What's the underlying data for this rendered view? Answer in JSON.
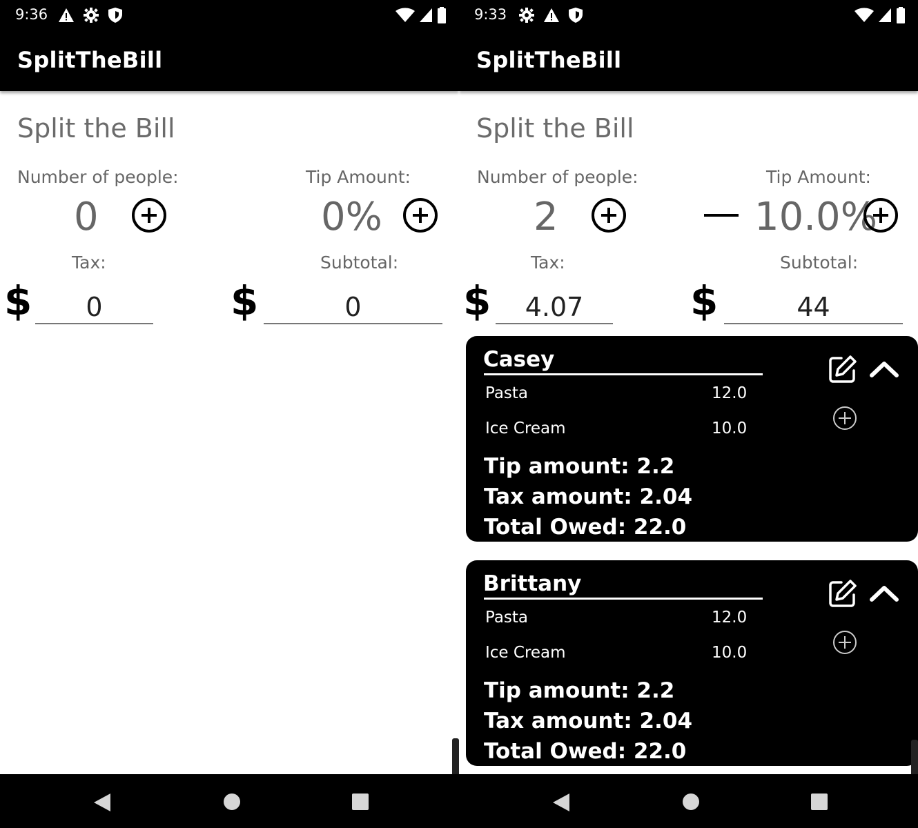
{
  "left": {
    "status": {
      "time": "9:36"
    },
    "app_title": "SplitTheBill",
    "heading": "Split the Bill",
    "people": {
      "label": "Number of people:",
      "value": "0"
    },
    "tip": {
      "label": "Tip Amount:",
      "value": "0%"
    },
    "tax": {
      "label": "Tax:",
      "currency": "$",
      "value": "0"
    },
    "subtotal": {
      "label": "Subtotal:",
      "currency": "$",
      "value": "0"
    }
  },
  "right": {
    "status": {
      "time": "9:33"
    },
    "app_title": "SplitTheBill",
    "heading": "Split the Bill",
    "people": {
      "label": "Number of people:",
      "value": "2"
    },
    "tip": {
      "label": "Tip Amount:",
      "value": "10.0%"
    },
    "tax": {
      "label": "Tax:",
      "currency": "$",
      "value": "4.07"
    },
    "subtotal": {
      "label": "Subtotal:",
      "currency": "$",
      "value": "44"
    },
    "people_cards": [
      {
        "name": "Casey",
        "items": [
          {
            "name": "Pasta",
            "price": "12.0"
          },
          {
            "name": "Ice Cream",
            "price": "10.0"
          }
        ],
        "tip_text": "Tip amount: 2.2",
        "tax_text": "Tax amount: 2.04",
        "total_text": "Total Owed: 22.0"
      },
      {
        "name": "Brittany",
        "items": [
          {
            "name": "Pasta",
            "price": "12.0"
          },
          {
            "name": "Ice Cream",
            "price": "10.0"
          }
        ],
        "tip_text": "Tip amount: 2.2",
        "tax_text": "Tax amount: 2.04",
        "total_text": "Total Owed: 22.0"
      }
    ]
  },
  "icons": [
    "warning-icon",
    "settings-icon",
    "shield-icon",
    "wifi-icon",
    "signal-icon",
    "battery-icon",
    "add-circle-icon",
    "minus-icon",
    "edit-icon",
    "chevron-up-icon",
    "back-icon",
    "home-icon",
    "recents-icon"
  ],
  "colors": {
    "bar": "#000000",
    "label": "#666666",
    "card": "#000000",
    "card_text": "#ffffff"
  }
}
